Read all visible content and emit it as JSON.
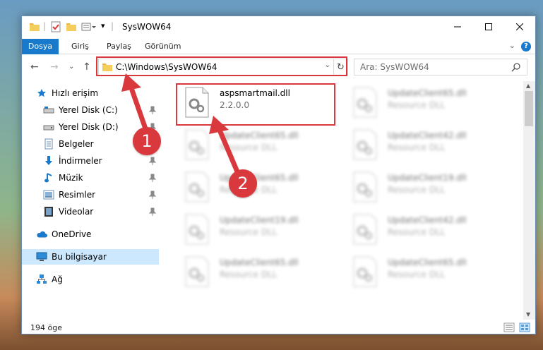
{
  "window": {
    "title": "SysWOW64"
  },
  "ribbon": {
    "tabs": [
      {
        "label": "Dosya"
      },
      {
        "label": "Giriş"
      },
      {
        "label": "Paylaş"
      },
      {
        "label": "Görünüm"
      }
    ],
    "help_label": "?"
  },
  "nav": {
    "address": "C:\\Windows\\SysWOW64",
    "search_placeholder": "Ara: SysWOW64"
  },
  "sidebar": {
    "items": [
      {
        "label": "Hızlı erişim",
        "icon": "star-icon"
      },
      {
        "label": "Yerel Disk (C:)",
        "icon": "drive-icon",
        "pinned": true
      },
      {
        "label": "Yerel Disk (D:)",
        "icon": "drive-icon",
        "pinned": true
      },
      {
        "label": "Belgeler",
        "icon": "documents-icon",
        "pinned": true
      },
      {
        "label": "İndirmeler",
        "icon": "download-icon",
        "pinned": true
      },
      {
        "label": "Müzik",
        "icon": "music-icon",
        "pinned": true
      },
      {
        "label": "Resimler",
        "icon": "pictures-icon",
        "pinned": true
      },
      {
        "label": "Videolar",
        "icon": "videos-icon",
        "pinned": true
      },
      {
        "label": "OneDrive",
        "icon": "cloud-icon"
      },
      {
        "label": "Bu bilgisayar",
        "icon": "computer-icon",
        "selected": true
      },
      {
        "label": "Ağ",
        "icon": "network-icon"
      }
    ]
  },
  "files": [
    {
      "name": "aspsmartmail.dll",
      "desc": "2.2.0.0",
      "highlighted": true
    },
    {
      "name": "UpdateClient65.dll",
      "desc": "Resource DLL"
    },
    {
      "name": "UpdateClient65.dll",
      "desc": "Resource DLL"
    },
    {
      "name": "UpdateClient42.dll",
      "desc": "Resource DLL"
    },
    {
      "name": "UpdateClient65.dll",
      "desc": "Resource DLL"
    },
    {
      "name": "UpdateClient19.dll",
      "desc": "Resource DLL"
    },
    {
      "name": "UpdateClient19.dll",
      "desc": "Resource DLL"
    },
    {
      "name": "UpdateClient42.dll",
      "desc": "Resource DLL"
    },
    {
      "name": "UpdateClient65.dll",
      "desc": "Resource DLL"
    },
    {
      "name": "UpdateClient65.dll",
      "desc": "Resource DLL"
    }
  ],
  "status": {
    "count": "194 öge"
  },
  "annotations": {
    "step1": "1",
    "step2": "2",
    "color": "#d9383c"
  },
  "colors": {
    "accent": "#1979ca",
    "selected_bg": "#cce8ff",
    "annotation": "#d9383c"
  }
}
